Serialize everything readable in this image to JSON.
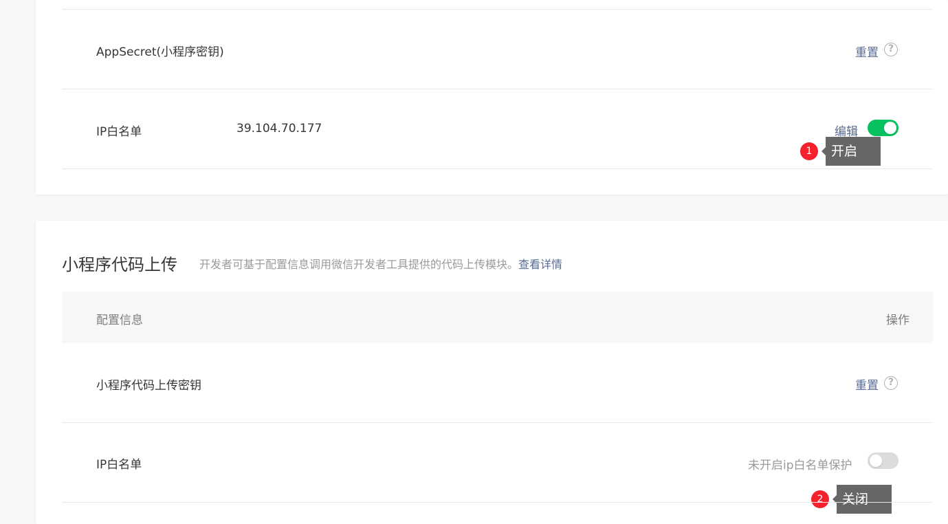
{
  "card1": {
    "rows": [
      {
        "label": "AppSecret(小程序密钥)",
        "action": "重置",
        "help": "?"
      },
      {
        "label": "IP白名单",
        "value": "39.104.70.177",
        "action": "编辑",
        "toggle": "on"
      }
    ],
    "tooltip": {
      "number": "1",
      "text": "开启"
    }
  },
  "card2": {
    "title": "小程序代码上传",
    "description": "开发者可基于配置信息调用微信开发者工具提供的代码上传模块。",
    "description_link": "查看详情",
    "table_headers": [
      "配置信息",
      "操作"
    ],
    "rows": [
      {
        "label": "小程序代码上传密钥",
        "action": "重置",
        "help": "?"
      },
      {
        "label": "IP白名单",
        "status": "未开启ip白名单保护",
        "toggle": "off"
      }
    ],
    "tooltip": {
      "number": "2",
      "text": "关闭"
    }
  },
  "colors": {
    "link": "#576b95",
    "toggle_on": "#07c160",
    "toggle_off": "#dcdcdc",
    "badge": "#f5222d",
    "tooltip_bg": "#666666"
  }
}
